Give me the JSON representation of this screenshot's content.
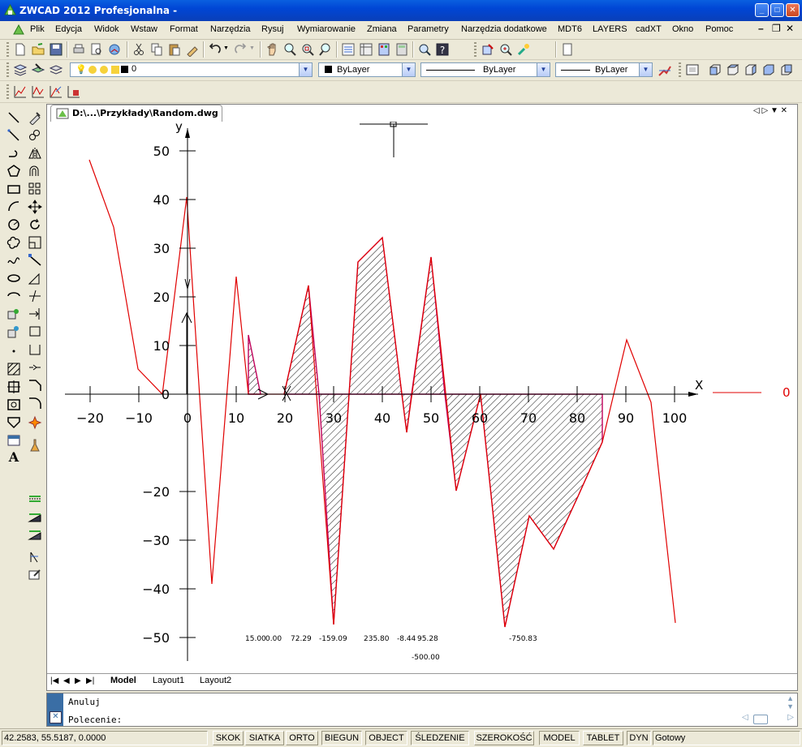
{
  "window": {
    "title": "ZWCAD 2012 Profesjonalna -"
  },
  "menu": {
    "items": [
      "Plik",
      "Edycja",
      "Widok",
      "Wstaw",
      "Format",
      "Narzędzia",
      "Rysuj",
      "Wymiarowanie",
      "Zmiana",
      "Parametry",
      "Narzędzia dodatkowe",
      "MDT6",
      "LAYERS",
      "cadXT",
      "Okno",
      "Pomoc"
    ]
  },
  "properties": {
    "layer_value": "0",
    "color_value": "ByLayer",
    "linetype_value": "ByLayer",
    "lineweight_value": "ByLayer"
  },
  "document": {
    "tab_title": "D:\\...\\Przykłady\\Random.dwg"
  },
  "drawing": {
    "y_axis_letter": "y",
    "x_axis_letter": "X",
    "x_ticks": [
      "-20",
      "-10",
      "0",
      "10",
      "20",
      "30",
      "40",
      "50",
      "60",
      "70",
      "80",
      "90",
      "100"
    ],
    "y_ticks_pos": [
      "10",
      "20",
      "30",
      "40",
      "50"
    ],
    "y_zero": "0",
    "y_ticks_neg": [
      "-20",
      "-30",
      "-40",
      "-50"
    ],
    "legend_value": "0",
    "area_values": [
      "15.00",
      "0.00",
      "72.29",
      "-159.09",
      "235.80",
      "-8.44",
      "95.28",
      "-750.83",
      "-500.00"
    ],
    "line_color": "#e00000",
    "hatch_color": "#c0005a"
  },
  "layout_tabs": {
    "model": "Model",
    "layout1": "Layout1",
    "layout2": "Layout2"
  },
  "command": {
    "line1": "Anuluj",
    "line2": "Polecenie:"
  },
  "status": {
    "coords": "42.2583,  55.5187,  0.0000",
    "buttons": [
      "SKOK",
      "SIATKA",
      "ORTO",
      "BIEGUN",
      "OBJECT",
      "ŚLEDZENIE",
      "SZEROKOŚĆ",
      "MODEL",
      "TABLET",
      "DYN"
    ],
    "state": "Gotowy"
  },
  "colors": {
    "titlebar": "#0046d5",
    "chrome": "#ece9d8",
    "accent": "#e00000"
  }
}
